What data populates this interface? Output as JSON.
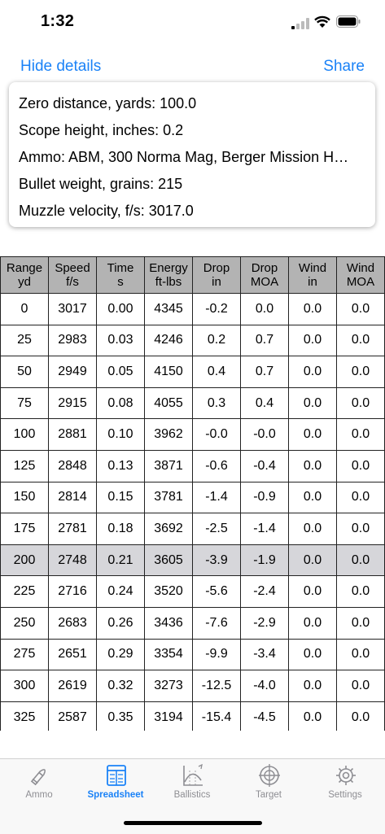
{
  "status_bar": {
    "time": "1:32"
  },
  "nav": {
    "hide_details": "Hide details",
    "share": "Share"
  },
  "details": [
    "Zero distance, yards: 100.0",
    "Scope height, inches: 0.2",
    "Ammo: ABM, 300 Norma Mag, Berger Mission H…",
    "Bullet weight, grains: 215",
    "Muzzle velocity, f/s: 3017.0"
  ],
  "table": {
    "headers": [
      [
        "Range",
        "yd"
      ],
      [
        "Speed",
        "f/s"
      ],
      [
        "Time",
        "s"
      ],
      [
        "Energy",
        "ft-lbs"
      ],
      [
        "Drop",
        "in"
      ],
      [
        "Drop",
        "MOA"
      ],
      [
        "Wind",
        "in"
      ],
      [
        "Wind",
        "MOA"
      ]
    ],
    "rows": [
      [
        "0",
        "3017",
        "0.00",
        "4345",
        "-0.2",
        "0.0",
        "0.0",
        "0.0"
      ],
      [
        "25",
        "2983",
        "0.03",
        "4246",
        "0.2",
        "0.7",
        "0.0",
        "0.0"
      ],
      [
        "50",
        "2949",
        "0.05",
        "4150",
        "0.4",
        "0.7",
        "0.0",
        "0.0"
      ],
      [
        "75",
        "2915",
        "0.08",
        "4055",
        "0.3",
        "0.4",
        "0.0",
        "0.0"
      ],
      [
        "100",
        "2881",
        "0.10",
        "3962",
        "-0.0",
        "-0.0",
        "0.0",
        "0.0"
      ],
      [
        "125",
        "2848",
        "0.13",
        "3871",
        "-0.6",
        "-0.4",
        "0.0",
        "0.0"
      ],
      [
        "150",
        "2814",
        "0.15",
        "3781",
        "-1.4",
        "-0.9",
        "0.0",
        "0.0"
      ],
      [
        "175",
        "2781",
        "0.18",
        "3692",
        "-2.5",
        "-1.4",
        "0.0",
        "0.0"
      ],
      [
        "200",
        "2748",
        "0.21",
        "3605",
        "-3.9",
        "-1.9",
        "0.0",
        "0.0"
      ],
      [
        "225",
        "2716",
        "0.24",
        "3520",
        "-5.6",
        "-2.4",
        "0.0",
        "0.0"
      ],
      [
        "250",
        "2683",
        "0.26",
        "3436",
        "-7.6",
        "-2.9",
        "0.0",
        "0.0"
      ],
      [
        "275",
        "2651",
        "0.29",
        "3354",
        "-9.9",
        "-3.4",
        "0.0",
        "0.0"
      ],
      [
        "300",
        "2619",
        "0.32",
        "3273",
        "-12.5",
        "-4.0",
        "0.0",
        "0.0"
      ],
      [
        "325",
        "2587",
        "0.35",
        "3194",
        "-15.4",
        "-4.5",
        "0.0",
        "0.0"
      ]
    ],
    "highlight_row": 8
  },
  "tabs": [
    {
      "label": "Ammo",
      "icon": "bullet-icon",
      "active": false
    },
    {
      "label": "Spreadsheet",
      "icon": "spreadsheet-icon",
      "active": true
    },
    {
      "label": "Ballistics",
      "icon": "ballistics-chart-icon",
      "active": false
    },
    {
      "label": "Target",
      "icon": "crosshair-icon",
      "active": false
    },
    {
      "label": "Settings",
      "icon": "gear-icon",
      "active": false
    }
  ],
  "colors": {
    "accent": "#1a82f7",
    "inactive": "#8e8e93",
    "header_bg": "#b3b3b3",
    "highlight_bg": "#d6d6da"
  }
}
